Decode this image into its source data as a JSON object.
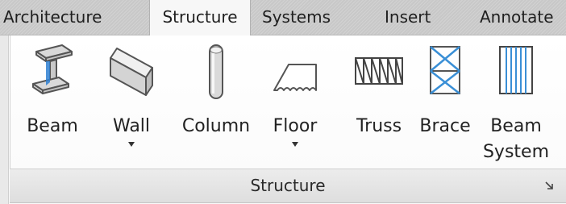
{
  "tabs": [
    {
      "label": "Architecture",
      "active": false
    },
    {
      "label": "Structure",
      "active": true
    },
    {
      "label": "Systems",
      "active": false
    },
    {
      "label": "Insert",
      "active": false
    },
    {
      "label": "Annotate",
      "active": false
    }
  ],
  "panel": {
    "title": "Structure",
    "tools": [
      {
        "label": "Beam",
        "icon": "beam-icon",
        "has_dropdown": false
      },
      {
        "label": "Wall",
        "icon": "wall-icon",
        "has_dropdown": true
      },
      {
        "label": "Column",
        "icon": "column-icon",
        "has_dropdown": false
      },
      {
        "label": "Floor",
        "icon": "floor-icon",
        "has_dropdown": true
      },
      {
        "label": "Truss",
        "icon": "truss-icon",
        "has_dropdown": false
      },
      {
        "label": "Brace",
        "icon": "brace-icon",
        "has_dropdown": false
      },
      {
        "label": "Beam",
        "label_line2": "System",
        "icon": "beam-system-icon",
        "has_dropdown": false
      }
    ],
    "launcher_icon": "dialog-launcher-icon"
  },
  "colors": {
    "tab_strip": "#c8c8c8",
    "active_tab": "#f7f7f7",
    "accent_blue": "#3a8fd6",
    "panel_title_bar": "#e4e4e4"
  }
}
